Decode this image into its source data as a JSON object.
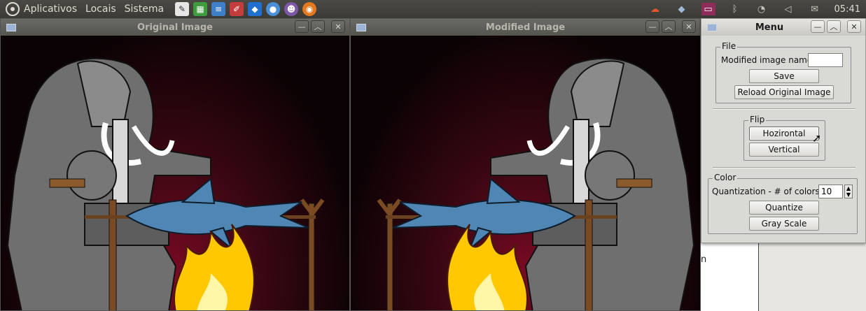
{
  "panel": {
    "menus": [
      "Aplicativos",
      "Locais",
      "Sistema"
    ],
    "launchers": [
      "text-editor-icon",
      "spreadsheet-icon",
      "document-icon",
      "paint-icon",
      "dropbox-icon",
      "chromium-icon",
      "pidgin-icon",
      "firefox-icon"
    ],
    "clock": "05:41"
  },
  "windows": {
    "original": {
      "title": "Original Image"
    },
    "modified": {
      "title": "Modified Image"
    }
  },
  "menu": {
    "title": "Menu",
    "file": {
      "legend": "File",
      "name_label": "Modified image name:",
      "name_value": "",
      "save_label": "Save",
      "reload_label": "Reload Original Image"
    },
    "flip": {
      "legend": "Flip",
      "horizontal_label": "Hozirontal",
      "vertical_label": "Vertical"
    },
    "color": {
      "legend": "Color",
      "colors_label": "Quantization - # of colors:",
      "colors_value": "10",
      "quantize_label": "Quantize",
      "grayscale_label": "Gray Scale"
    }
  },
  "background_fragment": "n",
  "colors": {
    "panel_bg": "#3b3a36",
    "fire": "#ffc800",
    "shark": "#4f86b3",
    "elephant": "#7a7a7a"
  }
}
